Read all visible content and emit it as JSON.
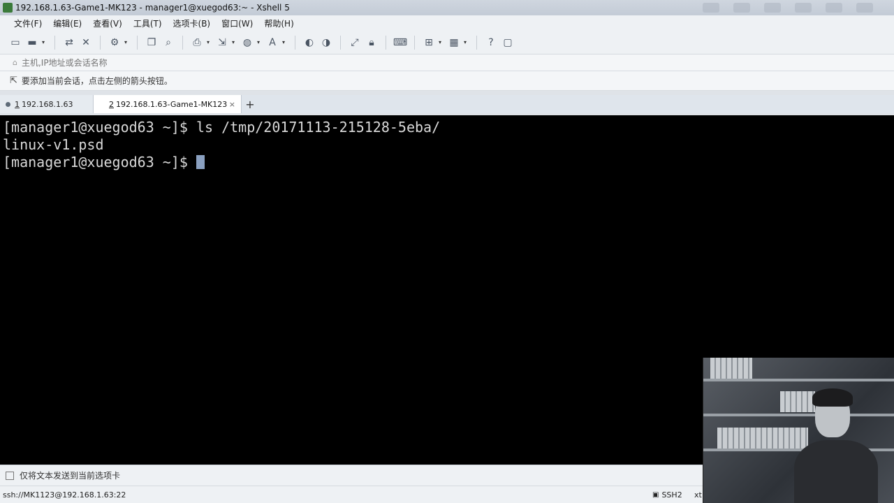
{
  "window": {
    "title": "192.168.1.63-Game1-MK123 - manager1@xuegod63:~ - Xshell 5"
  },
  "menu": [
    {
      "label": "文件(F)"
    },
    {
      "label": "编辑(E)"
    },
    {
      "label": "查看(V)"
    },
    {
      "label": "工具(T)"
    },
    {
      "label": "选项卡(B)"
    },
    {
      "label": "窗口(W)"
    },
    {
      "label": "帮助(H)"
    }
  ],
  "toolbar": {
    "icons": [
      "new-session-icon",
      "open-folder-icon",
      "reconnect-icon",
      "disconnect-icon",
      "properties-icon",
      "copy-icon",
      "find-icon",
      "print-icon",
      "transfer-icon",
      "globe-icon",
      "font-icon",
      "xftp-icon",
      "xmanager-icon",
      "fullscreen-icon",
      "lock-icon",
      "keyboard-icon",
      "new-tab-icon",
      "layout-icon",
      "help-icon",
      "chat-icon"
    ]
  },
  "address": {
    "placeholder": "主机,IP地址或会话名称"
  },
  "hint": {
    "text": "要添加当前会话，点击左侧的箭头按钮。"
  },
  "tabs": [
    {
      "number": "1",
      "label": "192.168.1.63"
    },
    {
      "number": "2",
      "label": "192.168.1.63-Game1-MK123",
      "close": "×"
    }
  ],
  "tab_add_label": "+",
  "terminal": {
    "lines": [
      "[manager1@xuegod63 ~]$ ls /tmp/20171113-215128-5eba/",
      "linux-v1.psd",
      "[manager1@xuegod63 ~]$ "
    ]
  },
  "sendbar": {
    "text": "仅将文本发送到当前选项卡"
  },
  "status": {
    "connection": "ssh://MK1123@192.168.1.63:22",
    "protocol": "SSH2",
    "terminal_type": "xt"
  }
}
